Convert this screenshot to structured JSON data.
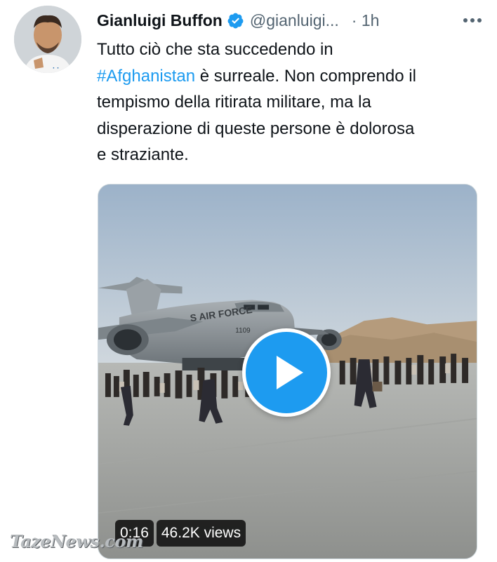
{
  "tweet": {
    "author_name": "Gianluigi Buffon",
    "handle": "@gianluigi...",
    "time": "· 1h",
    "text_parts": {
      "line1": "Tutto ciò che sta succedendo in",
      "hashtag": "#Afghanistan",
      "line2_rest": " è surreale. Non comprendo il",
      "line3": "tempismo della ritirata militare, ma la",
      "line4": "disperazione di queste persone è dolorosa",
      "line5": "e straziante."
    }
  },
  "video": {
    "duration": "0:16",
    "views": "46.2K views",
    "aircraft_markings": {
      "fuselage": "S AIR FORCE",
      "tail_number": "1109"
    }
  },
  "watermark": "TazeNews.com",
  "colors": {
    "hashtag": "#1d9bf0",
    "verified_badge": "#1d9bf0",
    "play_button": "#1d9bf0",
    "secondary_text": "#536471"
  },
  "icons": {
    "verified": "verified-badge-icon",
    "more": "more-options-icon",
    "play": "play-icon"
  }
}
